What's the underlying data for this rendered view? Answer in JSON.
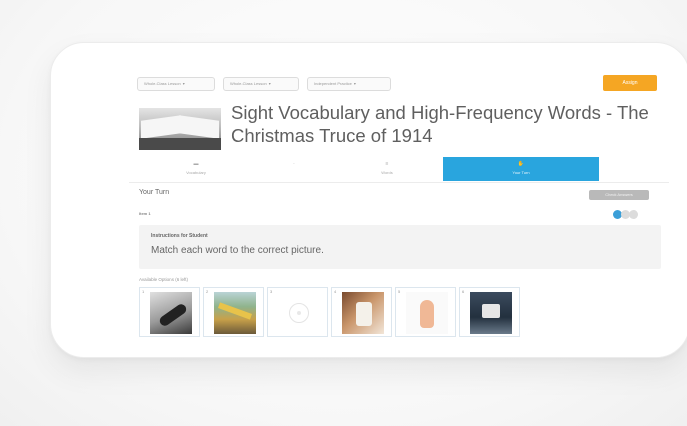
{
  "toolbar": {
    "dropdowns": [
      {
        "label": "Whole-Class Lesson"
      },
      {
        "label": "Whole-Class Lesson"
      },
      {
        "label": "Independent Practice"
      }
    ],
    "add_button": "Assign"
  },
  "lesson": {
    "title": "Sight Vocabulary and High-Frequency Words - The Christmas Truce of 1914"
  },
  "tabs": [
    {
      "label": "Vocabulary",
      "icon": "book-icon",
      "active": false
    },
    {
      "label": "",
      "icon": "ellipsis-icon",
      "active": false
    },
    {
      "label": "Words",
      "icon": "list-icon",
      "active": false
    },
    {
      "label": "Your Turn",
      "icon": "hand-icon",
      "active": true
    }
  ],
  "your_turn": {
    "label": "Your Turn",
    "button": "Check Answers"
  },
  "item": {
    "label": "Item 1",
    "pager": {
      "total": 3,
      "current": 1
    }
  },
  "instructions": {
    "title": "Instructions for Student",
    "text": "Match each word to the correct picture."
  },
  "options": {
    "label": "Available Options (6 left)",
    "tiles": [
      {
        "number": "1",
        "image": "boot-photo"
      },
      {
        "number": "2",
        "image": "field-photo"
      },
      {
        "number": "3",
        "image": "blank-circle"
      },
      {
        "number": "4",
        "image": "soldiers-photo"
      },
      {
        "number": "5",
        "image": "hand-photo"
      },
      {
        "number": "6",
        "image": "man-photo"
      }
    ]
  },
  "colors": {
    "accent_blue": "#29a5de",
    "button_orange": "#f5a623",
    "title_text": "#5f5f5f"
  }
}
